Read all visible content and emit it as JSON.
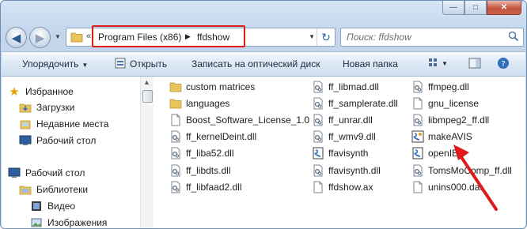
{
  "window": {
    "caption_buttons": {
      "minimize": "—",
      "maximize": "□",
      "close": "✕"
    }
  },
  "address": {
    "hidden_prefix": "«",
    "crumbs": [
      "Program Files (x86)",
      "ffdshow"
    ],
    "separator": "▶",
    "highlight_color": "#e01a1a"
  },
  "search": {
    "placeholder": "Поиск: ffdshow"
  },
  "toolbar": {
    "organize": "Упорядочить",
    "open": "Открыть",
    "burn": "Записать на оптический диск",
    "new_folder": "Новая папка"
  },
  "nav": {
    "favorites": "Избранное",
    "downloads": "Загрузки",
    "recent": "Недавние места",
    "desktop_fav": "Рабочий стол",
    "desktop": "Рабочий стол",
    "libraries": "Библиотеки",
    "video": "Видео",
    "images": "Изображения"
  },
  "files": {
    "col1": [
      {
        "name": "custom matrices",
        "type": "folder"
      },
      {
        "name": "languages",
        "type": "folder"
      },
      {
        "name": "Boost_Software_License_1.0",
        "type": "doc"
      },
      {
        "name": "ff_kernelDeint.dll",
        "type": "dll"
      },
      {
        "name": "ff_liba52.dll",
        "type": "dll"
      },
      {
        "name": "ff_libdts.dll",
        "type": "dll"
      },
      {
        "name": "ff_libfaad2.dll",
        "type": "dll"
      }
    ],
    "col2": [
      {
        "name": "ff_libmad.dll",
        "type": "dll"
      },
      {
        "name": "ff_samplerate.dll",
        "type": "dll"
      },
      {
        "name": "ff_unrar.dll",
        "type": "dll"
      },
      {
        "name": "ff_wmv9.dll",
        "type": "dll"
      },
      {
        "name": "ffavisynth",
        "type": "script"
      },
      {
        "name": "ffavisynth.dll",
        "type": "dll"
      },
      {
        "name": "ffdshow.ax",
        "type": "doc"
      }
    ],
    "col3": [
      {
        "name": "ffmpeg.dll",
        "type": "dll"
      },
      {
        "name": "gnu_license",
        "type": "doc"
      },
      {
        "name": "libmpeg2_ff.dll",
        "type": "dll"
      },
      {
        "name": "makeAVIS",
        "type": "exe",
        "selected": true
      },
      {
        "name": "openIE",
        "type": "script"
      },
      {
        "name": "TomsMoComp_ff.dll",
        "type": "dll"
      },
      {
        "name": "unins000.dat",
        "type": "doc"
      }
    ]
  },
  "annotation_color": "#e01a1a"
}
